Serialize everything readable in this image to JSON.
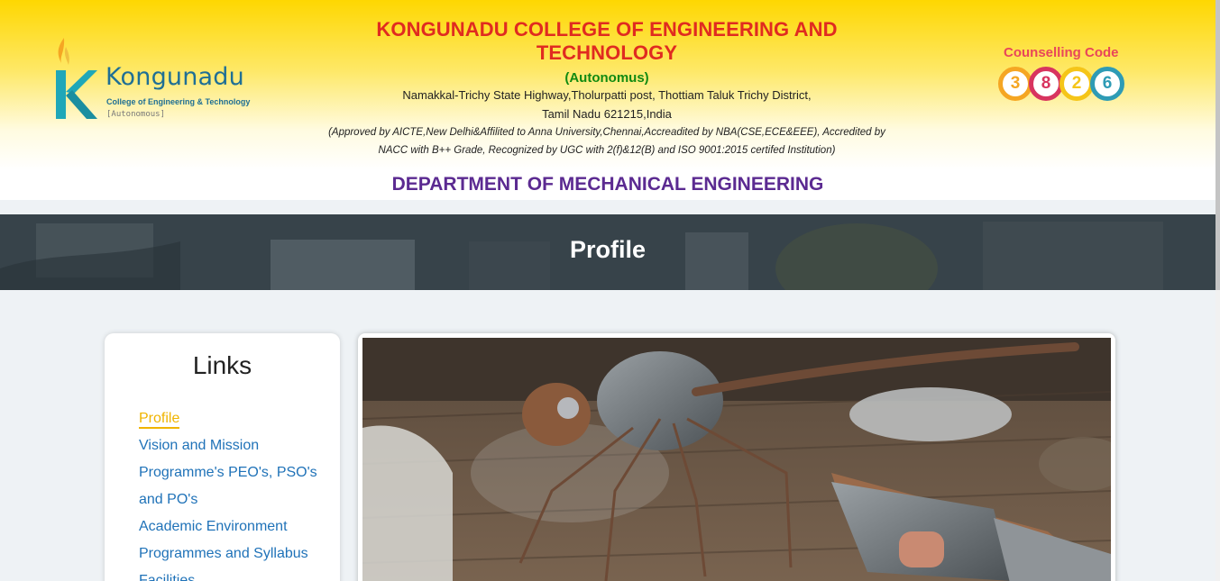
{
  "header": {
    "logo": {
      "name": "Kongunadu",
      "subtitle": "College of Engineering & Technology",
      "tag": "[Autonomous]"
    },
    "college_title": "KONGUNADU COLLEGE OF ENGINEERING AND TECHNOLOGY",
    "autonomous": "(Autonomus)",
    "address_line1": "Namakkal-Trichy State Highway,Tholurpatti post, Thottiam Taluk Trichy District,",
    "address_line2": "Tamil Nadu 621215,India",
    "approval_line1": "(Approved by AICTE,New Delhi&Affilited to Anna University,Chennai,Accreadited by NBA(CSE,ECE&EEE), Accredited by",
    "approval_line2": "NACC with B++ Grade, Recognized by UGC with 2(f)&12(B) and ISO 9001:2015 certifed Institution)",
    "counselling": {
      "label": "Counselling Code",
      "digits": [
        "3",
        "8",
        "2",
        "6"
      ],
      "colors": [
        "#f5a623",
        "#d8345f",
        "#f5c518",
        "#2e9bb5"
      ]
    },
    "department": "DEPARTMENT OF MECHANICAL ENGINEERING"
  },
  "banner": {
    "title": "Profile"
  },
  "links": {
    "title": "Links",
    "items": [
      "Profile",
      "Vision and Mission",
      "Programme's PEO's, PSO's",
      "and PO's",
      "Academic Environment",
      "Programmes and Syllabus",
      "Facilities"
    ],
    "active_color": "#f0b400",
    "link_color": "#1f72b8"
  },
  "colors": {
    "title_red": "#e02b20",
    "autonomous_green": "#118a11",
    "department_purple": "#5b2a91"
  }
}
